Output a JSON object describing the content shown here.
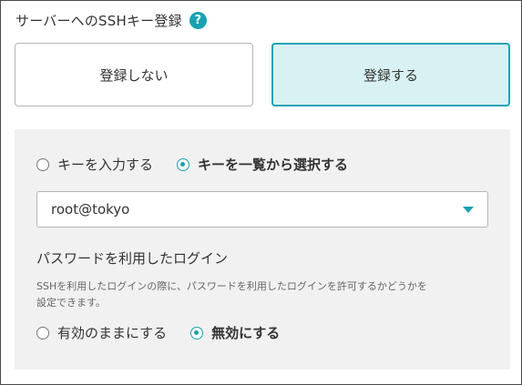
{
  "title": "サーバーへのSSHキー登録",
  "help_icon": "?",
  "register_options": {
    "no_label": "登録しない",
    "yes_label": "登録する",
    "selected": "yes"
  },
  "key_source": {
    "input_label": "キーを入力する",
    "select_label": "キーを一覧から選択する",
    "selected": "select"
  },
  "key_select": {
    "value": "root@tokyo"
  },
  "password_login": {
    "title": "パスワードを利用したログイン",
    "description_line1": "SSHを利用したログインの際に、パスワードを利用したログインを許可するかどうかを",
    "description_line2": "設定できます。",
    "keep_enabled_label": "有効のままにする",
    "disable_label": "無効にする",
    "selected": "disable"
  },
  "colors": {
    "accent": "#17a2b1",
    "selected_bg": "#d8f1f3",
    "panel_bg": "#f1f1f1"
  }
}
